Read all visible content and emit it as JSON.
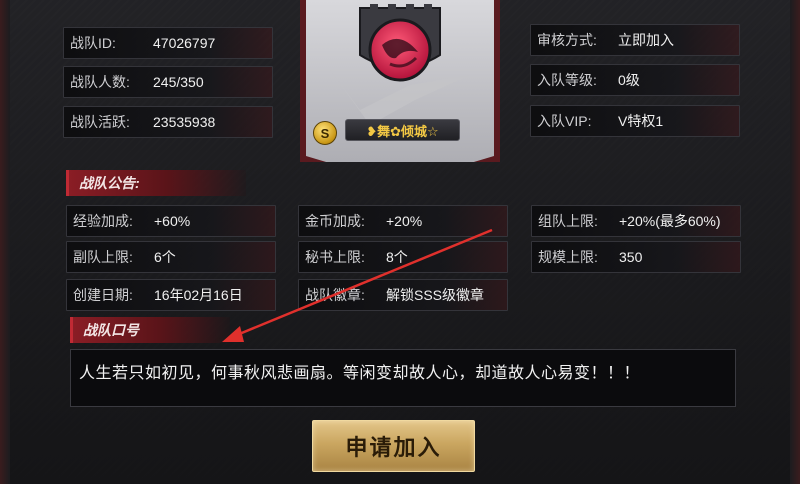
{
  "guild": {
    "left_info": [
      {
        "label": "战队ID:",
        "value": "47026797"
      },
      {
        "label": "战队人数:",
        "value": "245/350"
      },
      {
        "label": "战队活跃:",
        "value": "23535938"
      }
    ],
    "right_info": [
      {
        "label": "审核方式:",
        "value": "立即加入"
      },
      {
        "label": "入队等级:",
        "value": "0级"
      },
      {
        "label": "入队VIP:",
        "value": "V特权1"
      }
    ],
    "name": "❥舞✿倾城☆",
    "grade_badge": "S"
  },
  "announcement": {
    "title": "战队公告:",
    "rows": [
      [
        {
          "label": "经验加成:",
          "value": "+60%"
        },
        {
          "label": "金币加成:",
          "value": "+20%"
        },
        {
          "label": "组队上限:",
          "value": "+20%(最多60%)"
        }
      ],
      [
        {
          "label": "副队上限:",
          "value": "6个"
        },
        {
          "label": "秘书上限:",
          "value": "8个"
        },
        {
          "label": "规模上限:",
          "value": "350"
        }
      ],
      [
        {
          "label": "创建日期:",
          "value": "16年02月16日"
        },
        {
          "label": "战队徽章:",
          "value": "解锁SSS级徽章"
        }
      ]
    ]
  },
  "slogan": {
    "title": "战队口号",
    "text": "人生若只如初见，何事秋风悲画扇。等闲变却故人心，却道故人心易变！！！"
  },
  "apply_button": {
    "label": "申请加入"
  },
  "colors": {
    "accent_red": "#8a1d25",
    "button_gold": "#caa660",
    "name_gold": "#f2c744",
    "annotation_arrow": "#e0302c"
  }
}
